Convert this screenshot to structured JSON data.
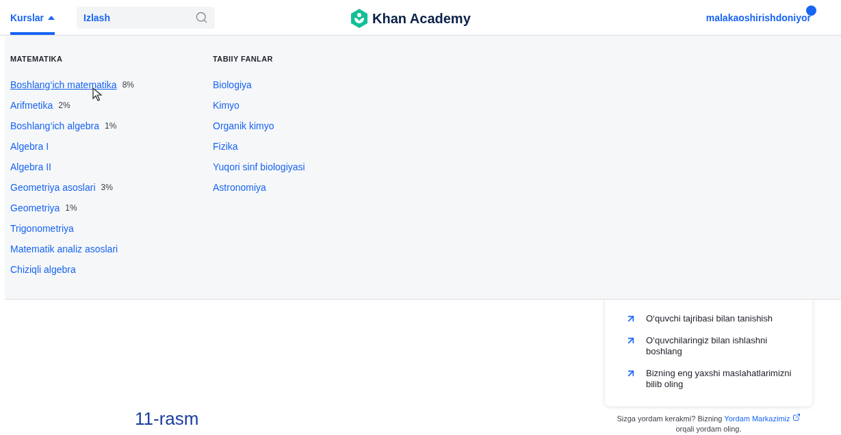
{
  "header": {
    "courses_button": {
      "label": "Kurslar",
      "expanded": true
    },
    "search": {
      "placeholder": "Izlash"
    },
    "logo": {
      "text": "Khan Academy"
    },
    "user": {
      "name": "malakaoshirishdoniyor",
      "notification": true
    }
  },
  "courses_menu": {
    "columns": [
      {
        "heading": "MATEMATIKA",
        "items": [
          {
            "label": "Boshlang‘ich matematika",
            "progress": "8%",
            "hovered": true
          },
          {
            "label": "Arifmetika",
            "progress": "2%",
            "hovered": false
          },
          {
            "label": "Boshlang‘ich algebra",
            "progress": "1%",
            "hovered": false
          },
          {
            "label": "Algebra I",
            "hovered": false
          },
          {
            "label": "Algebra II",
            "hovered": false
          },
          {
            "label": "Geometriya asoslari",
            "progress": "3%",
            "hovered": false
          },
          {
            "label": "Geometriya",
            "progress": "1%",
            "hovered": false
          },
          {
            "label": "Trigonometriya",
            "hovered": false
          },
          {
            "label": "Matematik analiz asoslari",
            "hovered": false
          },
          {
            "label": "Chiziqli algebra",
            "hovered": false
          }
        ]
      },
      {
        "heading": "TABIIY FANLAR",
        "items": [
          {
            "label": "Biologiya",
            "hovered": false
          },
          {
            "label": "Kimyo",
            "hovered": false
          },
          {
            "label": "Organik kimyo",
            "hovered": false
          },
          {
            "label": "Fizika",
            "hovered": false
          },
          {
            "label": "Yuqori sinf biologiyasi",
            "hovered": false
          },
          {
            "label": "Astronomiya",
            "hovered": false
          }
        ]
      }
    ]
  },
  "resources_card": {
    "links": [
      "O‘quvchi tajribasi bilan tanishish",
      "O‘quvchilaringiz bilan ishlashni boshlang",
      "Bizning eng yaxshi maslahatlarimizni bilib oling"
    ]
  },
  "help": {
    "text_before": "Sizga yordam kerakmi? Bizning",
    "link": "Yordam Markazimiz",
    "text_after": "orqali yordam oling."
  },
  "caption": "11-rasm"
}
